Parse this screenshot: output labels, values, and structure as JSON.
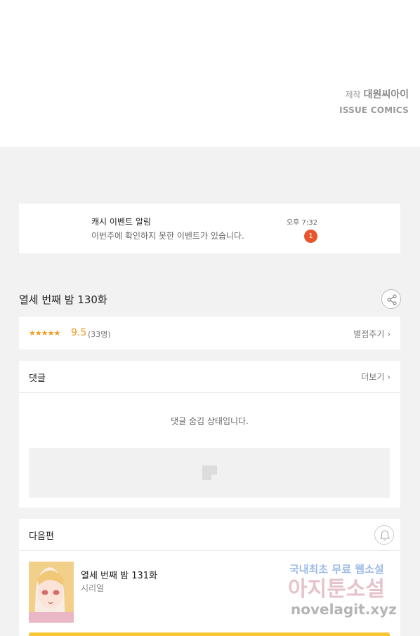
{
  "credit": {
    "label": "제작",
    "studio": "대원씨아이",
    "publisher": "ISSUE COMICS"
  },
  "notification": {
    "title": "캐시 이벤트 알림",
    "message": "이번주에 확인하지 못한 이벤트가 있습니다.",
    "time": "오후 7:32",
    "badge_count": "1",
    "badge_color": "#e8542b"
  },
  "episode": {
    "title": "열세 번째 밤 130화"
  },
  "rating": {
    "stars": "★★★★★",
    "score": "9.5",
    "count": "(33명)",
    "action_label": "별점주기 ›"
  },
  "comments": {
    "title": "댓글",
    "more_label": "더보기 ›",
    "hidden_message": "댓글 숨김 상태입니다."
  },
  "next": {
    "title": "다음편",
    "episode_title": "열세 번째 밤 131화",
    "episode_type": "시리얼"
  },
  "watermark": {
    "line1": "국내최초 무료",
    "line1_highlight": "웹소설",
    "line2": "아지툰소설",
    "line3": "novelagit.xyz"
  },
  "accent_color": "#f29b1e",
  "icons": {
    "share": "share-icon",
    "bell": "bell-icon"
  }
}
